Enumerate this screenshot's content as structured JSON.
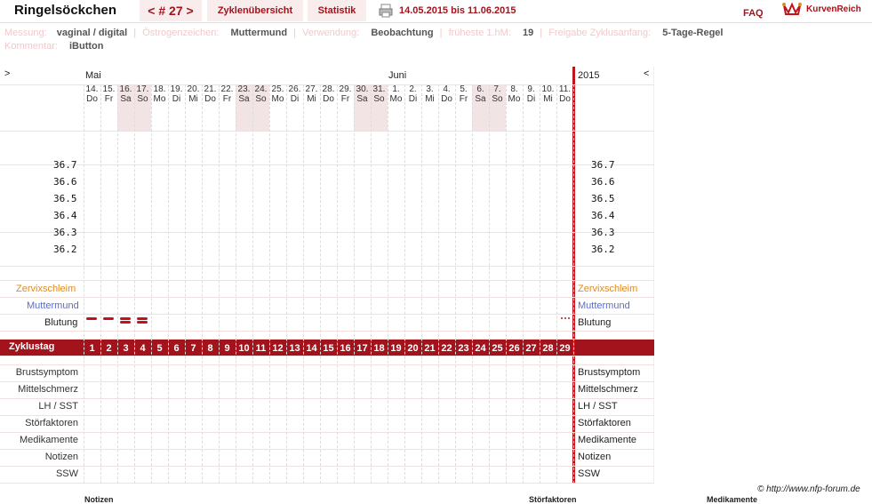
{
  "app": {
    "title": "Ringelsöckchen",
    "cycle_nav": "< # 27 >",
    "tab_overview": "Zyklenübersicht",
    "tab_stats": "Statistik",
    "date_range": "14.05.2015 bis 11.06.2015",
    "faq": "FAQ",
    "brand": "KurvenReich"
  },
  "meta": {
    "measure_label": "Messung:",
    "measure_value": "vaginal / digital",
    "estrogen_label": "Östrogenzeichen:",
    "estrogen_value": "Muttermund",
    "usage_label": "Verwendung:",
    "usage_value": "Beobachtung",
    "earliest_label": "früheste 1.hM:",
    "earliest_value": "19",
    "release_label": "Freigabe Zyklusanfang:",
    "release_value": "5-Tage-Regel",
    "comment_label": "Kommentar:",
    "comment_value": "iButton"
  },
  "chart": {
    "nav_left": ">",
    "nav_right": "<",
    "month1": "Mai",
    "month2": "Juni",
    "year": "2015",
    "days": [
      {
        "d": "14.",
        "w": "Do",
        "we": false
      },
      {
        "d": "15.",
        "w": "Fr",
        "we": false
      },
      {
        "d": "16.",
        "w": "Sa",
        "we": true
      },
      {
        "d": "17.",
        "w": "So",
        "we": true
      },
      {
        "d": "18.",
        "w": "Mo",
        "we": false
      },
      {
        "d": "19.",
        "w": "Di",
        "we": false
      },
      {
        "d": "20.",
        "w": "Mi",
        "we": false
      },
      {
        "d": "21.",
        "w": "Do",
        "we": false
      },
      {
        "d": "22.",
        "w": "Fr",
        "we": false
      },
      {
        "d": "23.",
        "w": "Sa",
        "we": true
      },
      {
        "d": "24.",
        "w": "So",
        "we": true
      },
      {
        "d": "25.",
        "w": "Mo",
        "we": false
      },
      {
        "d": "26.",
        "w": "Di",
        "we": false
      },
      {
        "d": "27.",
        "w": "Mi",
        "we": false
      },
      {
        "d": "28.",
        "w": "Do",
        "we": false
      },
      {
        "d": "29.",
        "w": "Fr",
        "we": false
      },
      {
        "d": "30.",
        "w": "Sa",
        "we": true
      },
      {
        "d": "31.",
        "w": "So",
        "we": true
      },
      {
        "d": "1.",
        "w": "Mo",
        "we": false
      },
      {
        "d": "2.",
        "w": "Di",
        "we": false
      },
      {
        "d": "3.",
        "w": "Mi",
        "we": false
      },
      {
        "d": "4.",
        "w": "Do",
        "we": false
      },
      {
        "d": "5.",
        "w": "Fr",
        "we": false
      },
      {
        "d": "6.",
        "w": "Sa",
        "we": true
      },
      {
        "d": "7.",
        "w": "So",
        "we": true
      },
      {
        "d": "8.",
        "w": "Mo",
        "we": false
      },
      {
        "d": "9.",
        "w": "Di",
        "we": false
      },
      {
        "d": "10.",
        "w": "Mi",
        "we": false
      },
      {
        "d": "11.",
        "w": "Do",
        "we": false
      }
    ],
    "temps": [
      "36.7",
      "36.6",
      "36.5",
      "36.4",
      "36.3",
      "36.2"
    ],
    "rows_top": {
      "cervix": "Zervixschleim",
      "mm": "Muttermund",
      "bleeding": "Blutung"
    },
    "cycle_label": "Zyklustag",
    "cycle_days": [
      "1",
      "2",
      "3",
      "4",
      "5",
      "6",
      "7",
      "8",
      "9",
      "10",
      "11",
      "12",
      "13",
      "14",
      "15",
      "16",
      "17",
      "18",
      "19",
      "20",
      "21",
      "22",
      "23",
      "24",
      "25",
      "26",
      "27",
      "28",
      "29"
    ],
    "rows_bottom": [
      "Brustsymptom",
      "Mittelschmerz",
      "LH / SST",
      "Störfaktoren",
      "Medikamente",
      "Notizen",
      "SSW"
    ],
    "bleeding_marks": [
      {
        "day": 1,
        "type": "single"
      },
      {
        "day": 2,
        "type": "single"
      },
      {
        "day": 3,
        "type": "double"
      },
      {
        "day": 4,
        "type": "double"
      },
      {
        "day": 29,
        "type": "dots"
      }
    ],
    "colors": {
      "accent": "#a3131c",
      "cervix": "#e48a1d",
      "mm": "#5a6bd0",
      "bleed": "#c0141c",
      "weekend": "#f2e3e5"
    }
  },
  "footer": {
    "copyright": "© http://www.nfp-forum.de",
    "bottom1": "Notizen",
    "bottom2": "Störfaktoren",
    "bottom3": "Medikamente"
  }
}
